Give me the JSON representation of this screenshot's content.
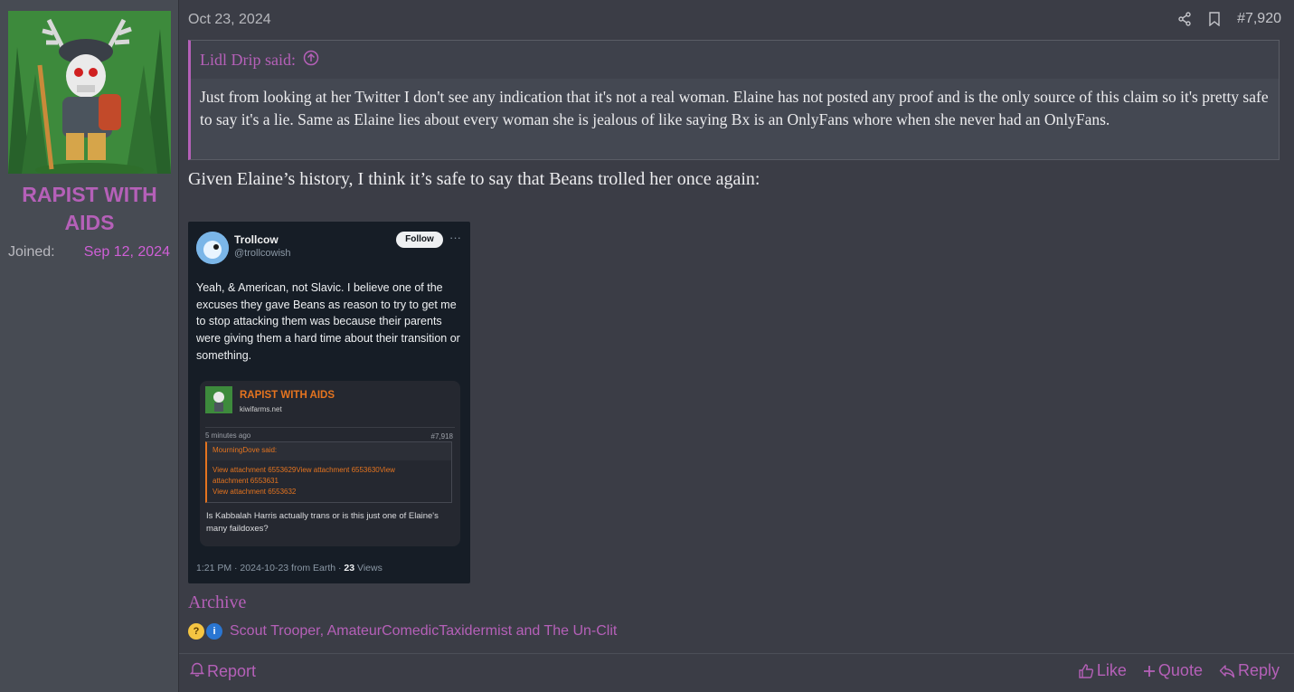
{
  "user": {
    "name": "RAPIST WITH AIDS",
    "joined_label": "Joined:",
    "joined_value": "Sep 12, 2024"
  },
  "post": {
    "date": "Oct 23, 2024",
    "number": "#7,920",
    "quote": {
      "author": "Lidl Drip said:",
      "text": "Just from looking at her Twitter I don't see any indication that it's not a real woman. Elaine has not posted any proof and is the only source of this claim so it's pretty safe to say it's a lie. Same as Elaine lies about every woman she is jealous of like saying Bx is an OnlyFans whore when she never had an OnlyFans."
    },
    "message": "Given Elaine’s history, I think it’s safe to say that Beans trolled her once again:",
    "archive_link": "Archive",
    "reactions": {
      "icons": [
        "thinking-face-icon",
        "info-icon"
      ],
      "names": "Scout Trooper, AmateurComedicTaxidermist and The Un-Clit"
    }
  },
  "tweet": {
    "name": "Trollcow",
    "handle": "@trollcowish",
    "follow": "Follow",
    "more": "···",
    "text": "Yeah, & American, not Slavic. I believe one of the excuses they gave Beans as reason to try to get me to stop attacking them was because their parents were giving them a hard time about their transition or something.",
    "card": {
      "name": "RAPIST WITH AIDS",
      "site": "kiwifarms.net",
      "time": "5 minutes ago",
      "number": "#7,918",
      "quote_author": "MourningDove said:",
      "quote_lines": [
        "View attachment 6553629View attachment 6553630View",
        "attachment 6553631",
        "View attachment 6553632"
      ],
      "text": "Is Kabbalah Harris actually trans or is this just one of Elaine's many faildoxes?"
    },
    "footer_prefix": "1:21 PM · 2024-10-23 from Earth · ",
    "views_count": "23",
    "views_label": " Views"
  },
  "actions": {
    "report": "Report",
    "like": "Like",
    "quote": "Quote",
    "reply": "Reply"
  },
  "colors": {
    "accent": "#b560b8",
    "joined": "#cf5fd6",
    "card_accent": "#e5741f"
  }
}
